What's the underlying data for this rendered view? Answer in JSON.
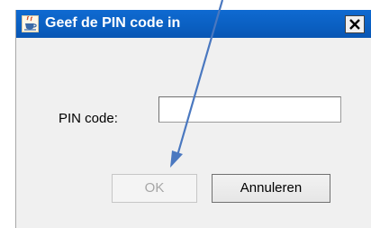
{
  "dialog": {
    "title": "Geef de PIN code in",
    "app_icon": "java-coffee-icon",
    "close_icon": "close-x-icon"
  },
  "form": {
    "pin_label": "PIN code:",
    "pin_value": ""
  },
  "buttons": {
    "ok_label": "OK",
    "ok_enabled": false,
    "cancel_label": "Annuleren"
  },
  "annotation": {
    "type": "arrow",
    "color": "#4a78c0"
  },
  "colors": {
    "titlebar": "#0a5fc1",
    "dialog_bg": "#f0f0f0",
    "disabled_text": "#a6a6a6"
  }
}
